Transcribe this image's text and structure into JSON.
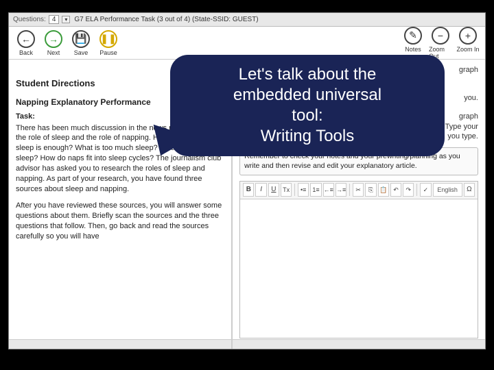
{
  "titlebar": {
    "questions_label": "Questions:",
    "current_num": "4",
    "task_title": "G7 ELA Performance Task (3 out of 4)  (State-SSID: GUEST)"
  },
  "toolbar": {
    "back": "Back",
    "next": "Next",
    "save": "Save",
    "pause": "Pause",
    "notes": "Notes",
    "zoom_out": "Zoom Out",
    "zoom_in": "Zoom In"
  },
  "left": {
    "heading": "Student Directions",
    "subheading": "Napping Explanatory Performance",
    "task_label": "Task:",
    "p1": "There has been much discussion in the news recently about the role of sleep and the role of napping. How many hours of sleep is enough? What is too much sleep? What is too little sleep? How do naps fit into sleep cycles? The journalism club advisor has asked you to research the roles of sleep and napping. As part of your research, you have found three sources about sleep and napping.",
    "p2": "After you have reviewed these sources, you will answer some questions about them. Briefly scan the sources and the three questions that follow. Then, go back and read the sources carefully so you will have"
  },
  "right": {
    "line_partial_1": "graph",
    "line_partial_2": "you.",
    "line_partial_3": "graph",
    "line_partial_4": "title. Type your",
    "line_partial_5": "you type.",
    "hint": "Remember to check your notes and your prewriting/planning as you write and then revise and edit your explanatory article."
  },
  "editor": {
    "bold": "B",
    "italic": "I",
    "underline": "U",
    "clear": "Tx",
    "bullets": "•≡",
    "numbers": "1≡",
    "outdent": "←≡",
    "indent": "→≡",
    "cut": "✂",
    "copy": "⎘",
    "paste": "📋",
    "undo": "↶",
    "redo": "↷",
    "spell": "✓",
    "lang": "English",
    "special": "Ω"
  },
  "callout": {
    "text": "Let's talk about the embedded universal tool:\nWriting Tools"
  }
}
